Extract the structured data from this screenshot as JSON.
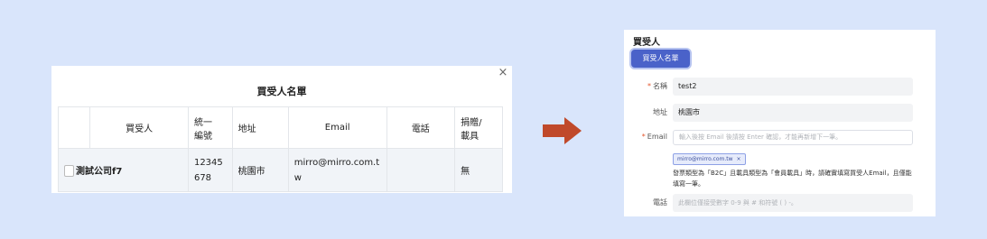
{
  "modal": {
    "close_symbol": "×",
    "title": "買受人名單",
    "columns": [
      "",
      "買受人",
      "統一\n編號",
      "地址",
      "Email",
      "電話",
      "捐贈/\n載具"
    ],
    "row": {
      "name": "測試公司f7",
      "tax_id": "12345678",
      "address": "桃園市",
      "email": "mirro@mirro.com.tw",
      "phone": "",
      "carrier": "無"
    }
  },
  "arrow_color": "#c0492a",
  "form": {
    "section_title": "買受人",
    "list_button": "買受人名單",
    "name_label": "名稱",
    "name_value": "test2",
    "address_label": "地址",
    "address_value": "桃園市",
    "email_label": "Email",
    "email_placeholder": "輸入後按 Email 後請按 Enter 確認，才能再新增下一筆。",
    "email_tag": "mirro@mirro.com.tw",
    "email_tag_close": "×",
    "note": "發票類型為「B2C」且載具類型為「會員載具」時，請確實填寫買受人Email，且僅能填寫一筆。",
    "phone_label": "電話",
    "phone_placeholder": "此欄位僅接受數字 0-9 與 # 和符號 ( ) -。"
  },
  "colors": {
    "background": "#d9e5fb",
    "accent": "#4a62c9",
    "required": "#e4572e"
  }
}
